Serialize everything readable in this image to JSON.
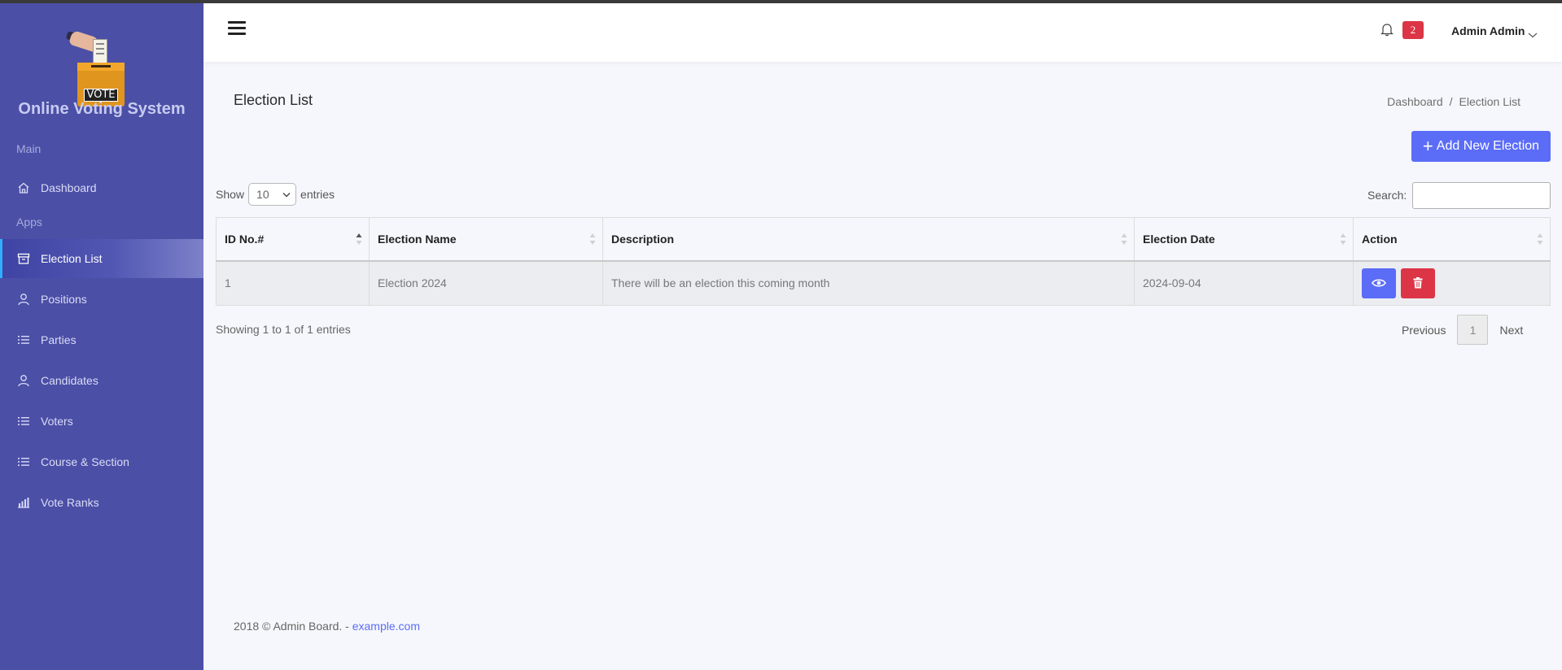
{
  "app": {
    "title": "Online Voting System",
    "logo_text": "VOTE"
  },
  "sidebar": {
    "sections": [
      {
        "label": "Main"
      },
      {
        "label": "Apps"
      }
    ],
    "items": [
      {
        "label": "Dashboard",
        "icon": "home-icon"
      },
      {
        "label": "Election List",
        "icon": "archive-box-icon",
        "active": true
      },
      {
        "label": "Positions",
        "icon": "user-icon"
      },
      {
        "label": "Parties",
        "icon": "list-icon"
      },
      {
        "label": "Candidates",
        "icon": "user-icon"
      },
      {
        "label": "Voters",
        "icon": "list-icon"
      },
      {
        "label": "Course & Section",
        "icon": "list-icon"
      },
      {
        "label": "Vote Ranks",
        "icon": "bar-chart-icon"
      }
    ]
  },
  "header": {
    "notification_count": "2",
    "user_name": "Admin Admin"
  },
  "page": {
    "title": "Election List",
    "breadcrumb": [
      "Dashboard",
      "Election List"
    ],
    "add_button_label": "Add New Election"
  },
  "table_controls": {
    "show_label": "Show",
    "entries_value": "10",
    "entries_label": "entries",
    "search_label": "Search:",
    "search_value": ""
  },
  "table": {
    "columns": [
      "ID No.#",
      "Election Name",
      "Description",
      "Election Date",
      "Action"
    ],
    "rows": [
      {
        "id": "1",
        "name": "Election 2024",
        "description": "There will be an election this coming month",
        "date": "2024-09-04"
      }
    ]
  },
  "pagination": {
    "info": "Showing 1 to 1 of 1 entries",
    "previous": "Previous",
    "current_page": "1",
    "next": "Next"
  },
  "footer": {
    "text": "2018 © Admin Board. - ",
    "link": "example.com"
  },
  "colors": {
    "sidebar_bg": "#4b4fa6",
    "primary": "#5b6cf7",
    "danger": "#dc3545",
    "active_indicator": "#2fb0ff"
  }
}
